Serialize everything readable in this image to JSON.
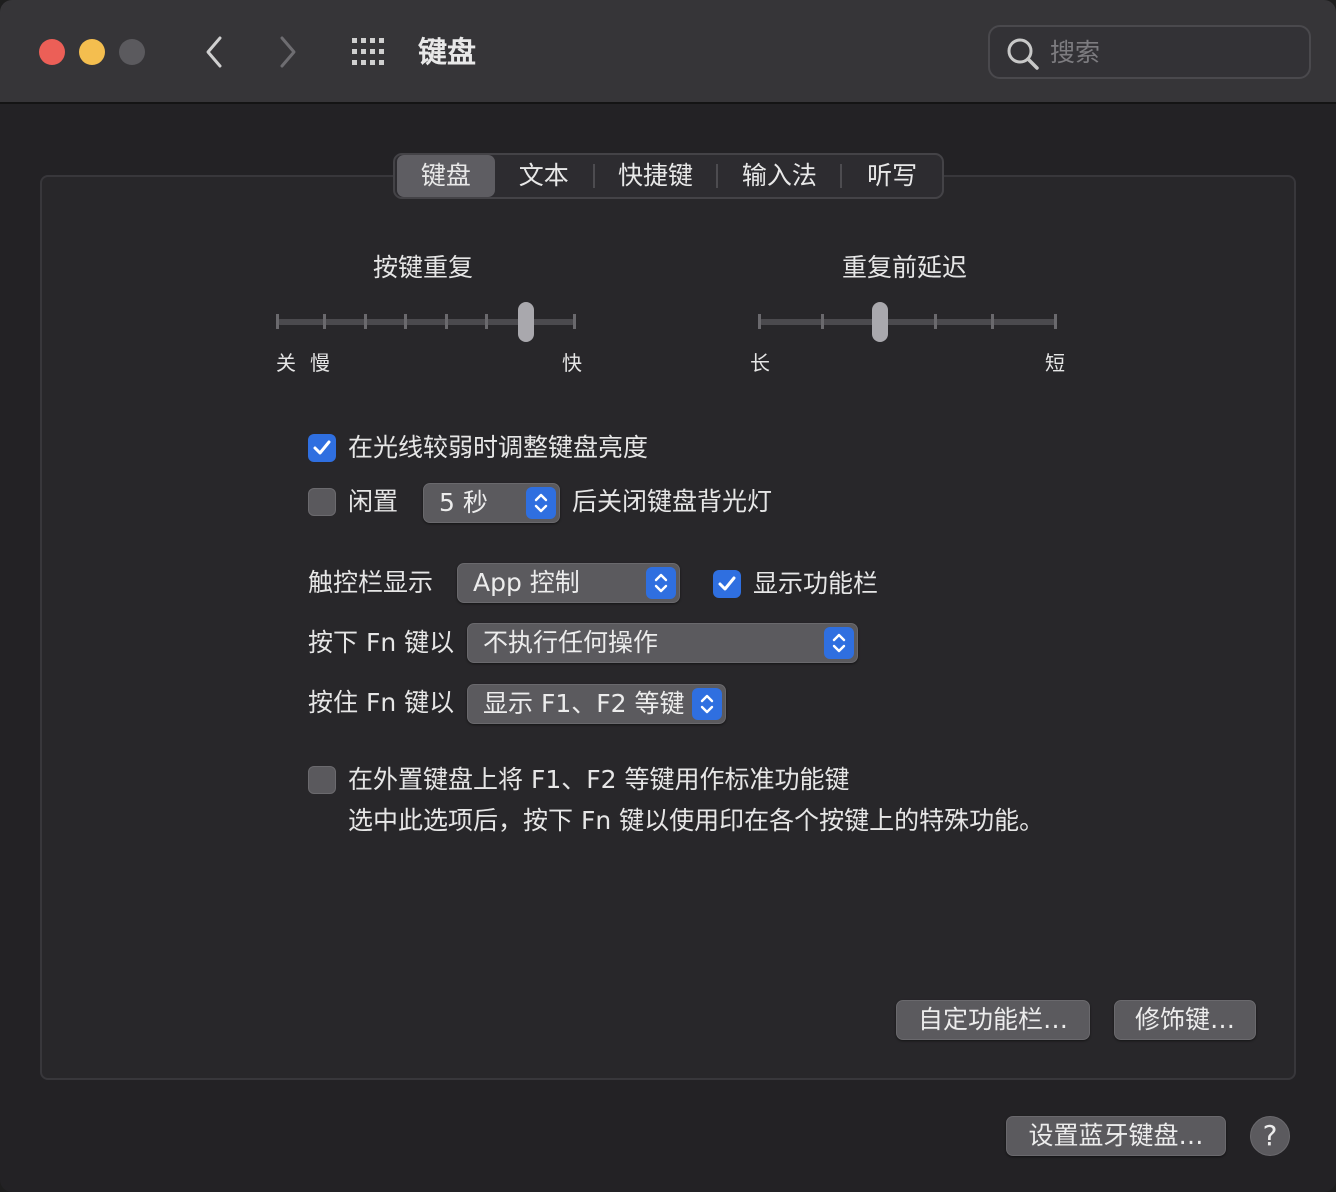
{
  "window": {
    "title": "键盘",
    "search": {
      "placeholder": "搜索"
    }
  },
  "tabs": [
    {
      "label": "键盘",
      "selected": true
    },
    {
      "label": "文本",
      "selected": false
    },
    {
      "label": "快捷键",
      "selected": false
    },
    {
      "label": "输入法",
      "selected": false
    },
    {
      "label": "听写",
      "selected": false
    }
  ],
  "key_repeat": {
    "title": "按键重复",
    "label_off": "关",
    "label_slow": "慢",
    "label_fast": "快",
    "stops": 8,
    "value_index": 6
  },
  "repeat_delay": {
    "title": "重复前延迟",
    "label_long": "长",
    "label_short": "短",
    "stops": 6,
    "value_index": 2
  },
  "options": {
    "adjust_brightness": {
      "label": "在光线较弱时调整键盘亮度",
      "checked": true
    },
    "backlight_off": {
      "prefix": "闲置",
      "value": "5 秒",
      "suffix": "后关闭键盘背光灯",
      "checked": false
    },
    "touch_bar_shows": {
      "label": "触控栏显示",
      "value": "App 控制"
    },
    "show_control_strip": {
      "label": "显示功能栏",
      "checked": true
    },
    "press_fn": {
      "label": "按下 Fn 键以",
      "value": "不执行任何操作"
    },
    "hold_fn": {
      "label": "按住 Fn 键以",
      "value": "显示 F1、F2 等键"
    },
    "use_f_keys": {
      "label": "在外置键盘上将 F1、F2 等键用作标准功能键",
      "description": "选中此选项后，按下 Fn 键以使用印在各个按键上的特殊功能。",
      "checked": false
    }
  },
  "buttons": {
    "customize_control_strip": "自定功能栏…",
    "modifier_keys": "修饰键…",
    "setup_bluetooth": "设置蓝牙键盘…",
    "help": "?"
  },
  "colors": {
    "accent": "#2f6fe0",
    "close": "#ec5f57",
    "minimize": "#f4be4f"
  }
}
